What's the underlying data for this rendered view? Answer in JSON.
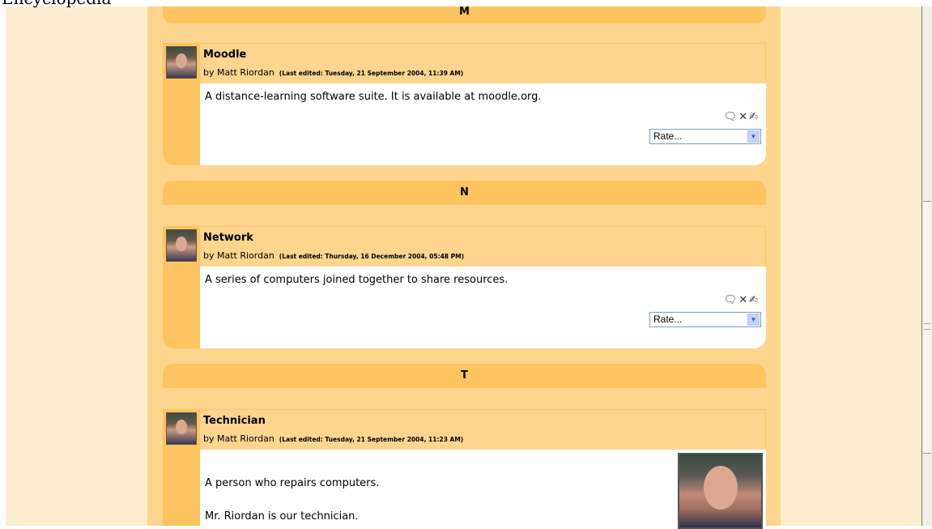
{
  "page": {
    "top_clipped_text": "Encyclopedia"
  },
  "sections": [
    {
      "letter": "M"
    },
    {
      "letter": "N"
    },
    {
      "letter": "T"
    }
  ],
  "entries": [
    {
      "title": "Moodle",
      "author": "by Matt Riordan",
      "edited": "(Last edited: Tuesday, 21 September 2004, 11:39 AM)",
      "text": "A distance-learning software suite. It is available at moodle.org.",
      "rate": "Rate..."
    },
    {
      "title": "Network",
      "author": "by Matt Riordan",
      "edited": "(Last edited: Thursday, 16 December 2004, 05:48 PM)",
      "text": "A series of computers joined together to share resources.",
      "rate": "Rate..."
    },
    {
      "title": "Technician",
      "author": "by Matt Riordan",
      "edited": "(Last edited: Tuesday, 21 September 2004, 11:23 AM)",
      "text": "A person who repairs computers.",
      "text2": "Mr. Riordan is our technician."
    }
  ],
  "icons": {
    "comment": "comment-icon",
    "delete": "delete-icon",
    "edit": "edit-icon"
  },
  "colors": {
    "tab": "#fec45f",
    "header": "#fdd58e",
    "background": "#fdeecf"
  }
}
